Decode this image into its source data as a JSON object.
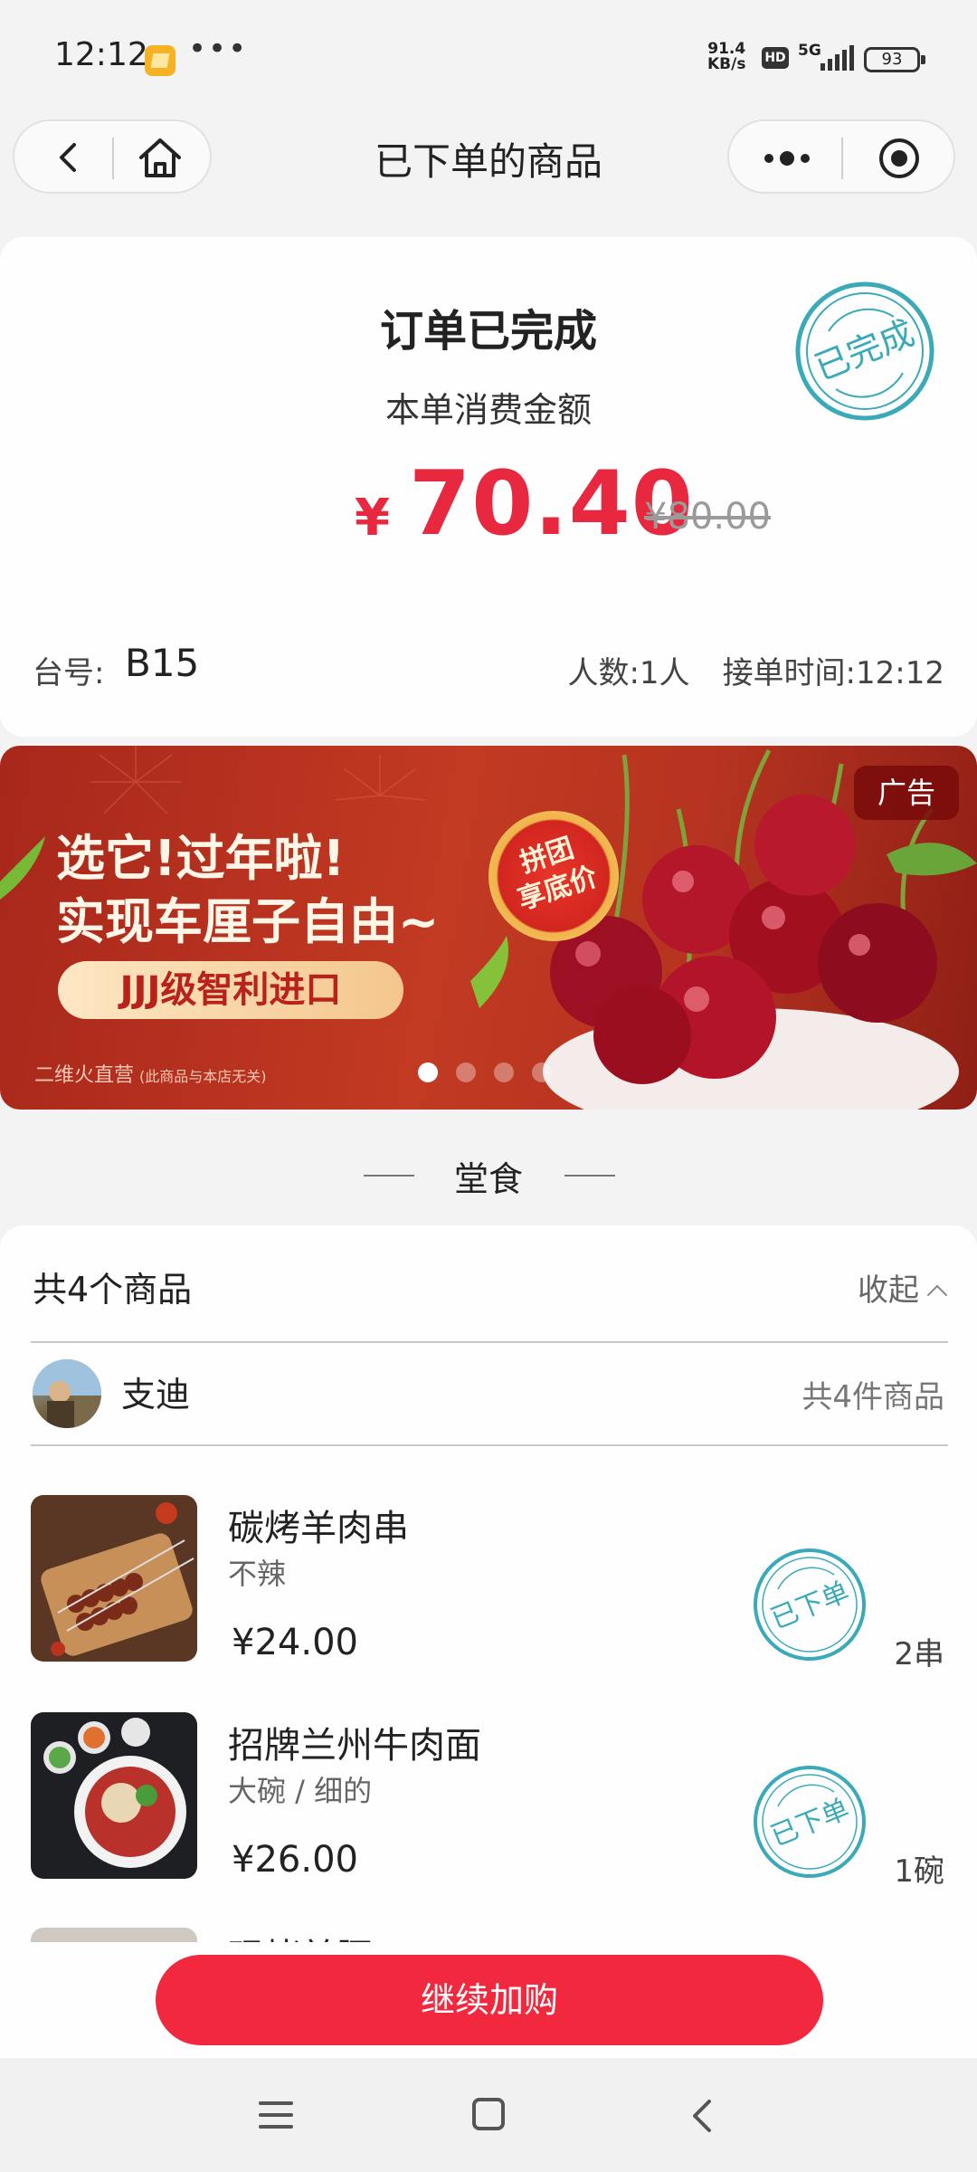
{
  "status_bar": {
    "time": "12:12",
    "menu_dots": "•••",
    "net_speed_value": "91.4",
    "net_speed_unit": "KB/s",
    "hd_label": "HD",
    "network_label": "5G",
    "battery": "93"
  },
  "nav": {
    "title": "已下单的商品"
  },
  "order": {
    "status_title": "订单已完成",
    "stamp_text": "已完成",
    "amount_label": "本单消费金额",
    "currency": "¥",
    "amount": "70.40",
    "original_amount": "¥80.00",
    "table_label": "台号:",
    "table_number": "B15",
    "people": "人数:1人",
    "order_time": "接单时间:12:12"
  },
  "ad": {
    "tag": "广告",
    "headline_line1": "选它!过年啦!",
    "headline_line2": "实现车厘子自由~",
    "pill_text": "JJJ级智利进口",
    "badge_line1": "拼团",
    "badge_line2": "享底价",
    "footnote": "二维火直营",
    "footnote_small": "(此商品与本店无关)",
    "slide_count": 4,
    "active_slide": 1
  },
  "section": {
    "heading": "堂食"
  },
  "items_summary": {
    "count_label": "共4个商品",
    "collapse_label": "收起"
  },
  "user": {
    "name": "支迪",
    "item_count": "共4件商品"
  },
  "items": [
    {
      "name": "碳烤羊肉串",
      "spec": "不辣",
      "price": "¥24.00",
      "qty": "2串",
      "stamp": "已下单"
    },
    {
      "name": "招牌兰州牛肉面",
      "spec": "大碗 / 细的",
      "price": "¥26.00",
      "qty": "1碗",
      "stamp": "已下单"
    },
    {
      "name": "现烤羊腰"
    }
  ],
  "actions": {
    "continue_label": "继续加购"
  },
  "colors": {
    "accent_red": "#f2283f",
    "price_red": "#e8283e",
    "stamp_teal": "#3aaab8"
  }
}
